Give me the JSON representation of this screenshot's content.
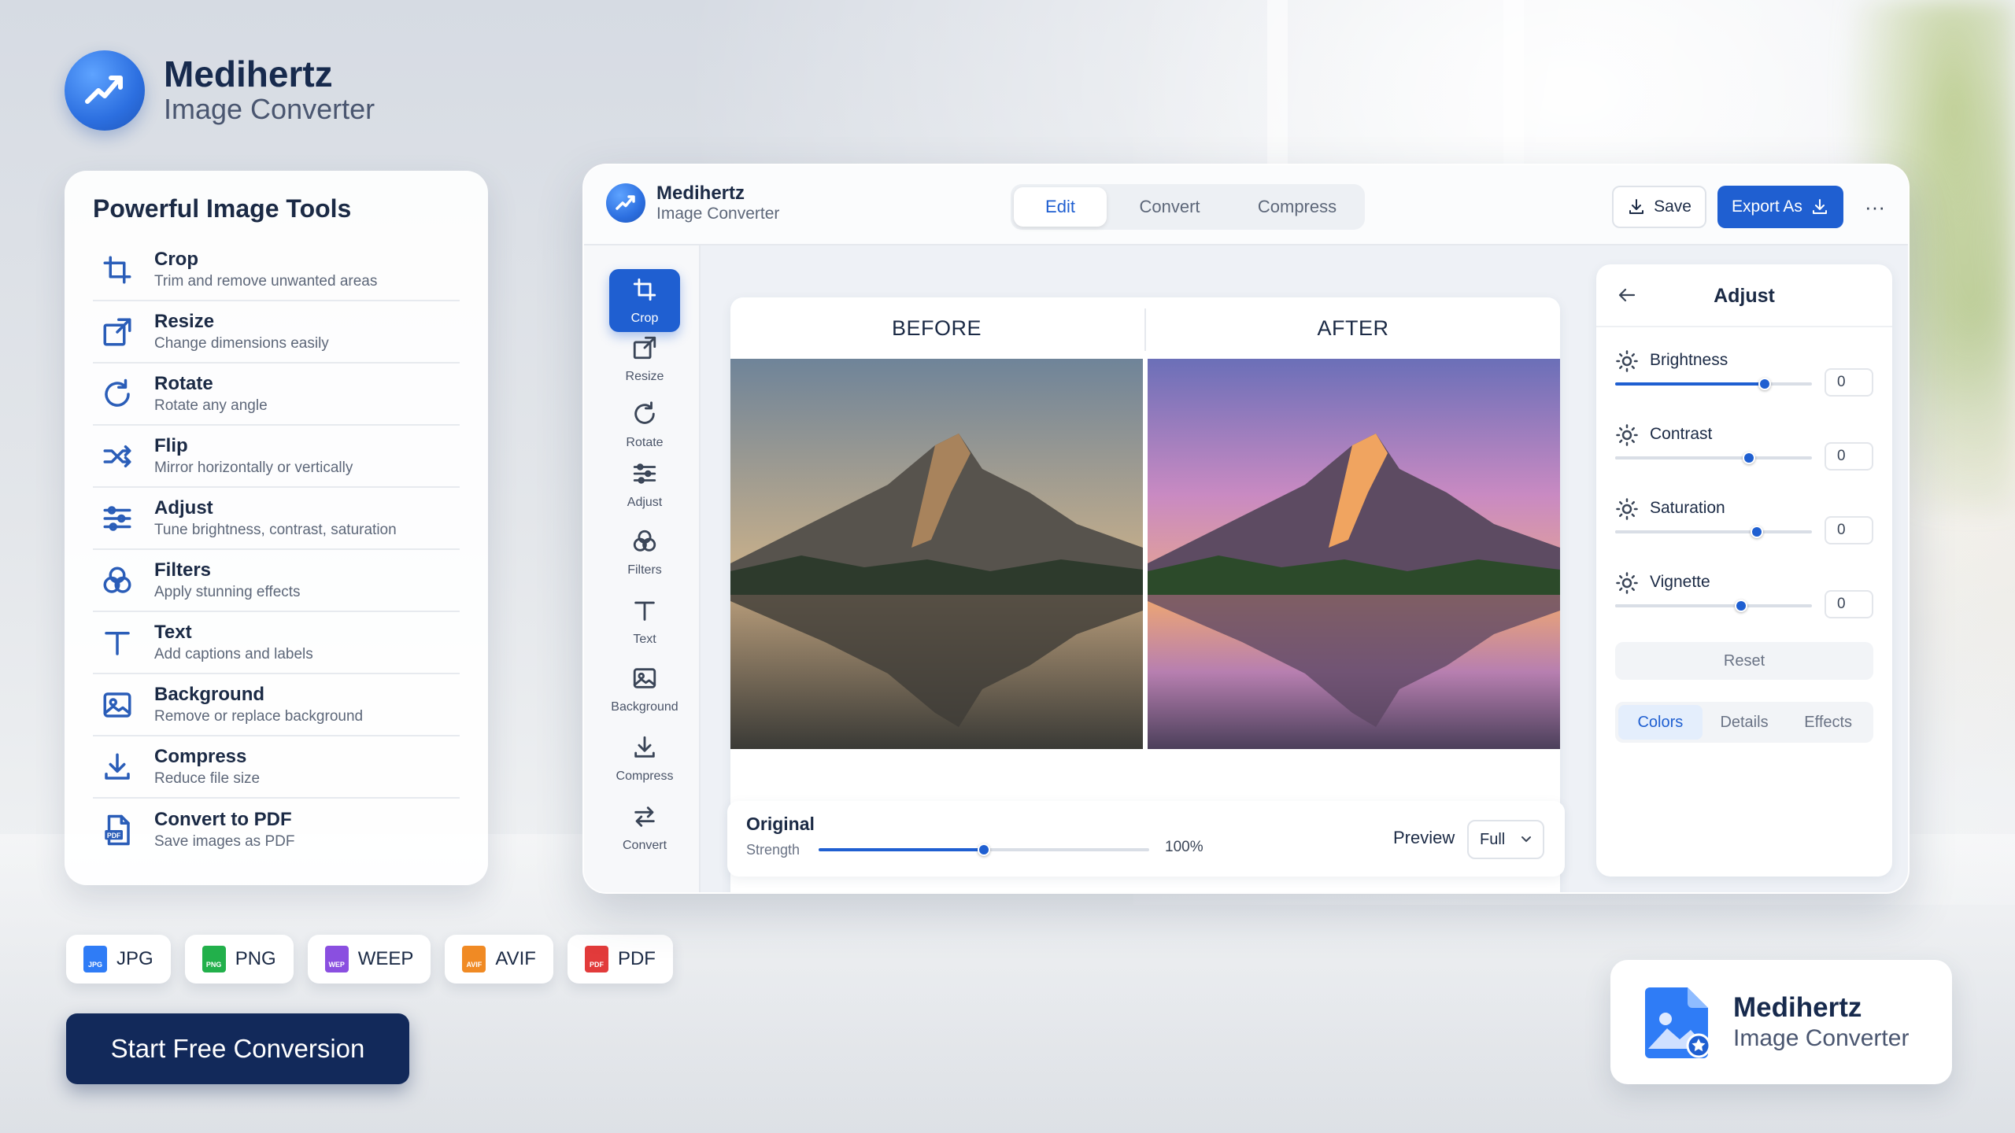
{
  "brand": {
    "name": "Medihertz",
    "subtitle": "Image Converter"
  },
  "tools_card": {
    "title": "Powerful Image Tools",
    "items": [
      {
        "name": "Crop",
        "desc": "Trim  and remove unwanted areas",
        "icon": "crop-icon"
      },
      {
        "name": "Resize",
        "desc": "Change dimensions easily",
        "icon": "resize-icon"
      },
      {
        "name": "Rotate",
        "desc": "Rotate any angle",
        "icon": "rotate-icon"
      },
      {
        "name": "Flip",
        "desc": "Mirror horizontally or vertically",
        "icon": "flip-icon"
      },
      {
        "name": "Adjust",
        "desc": "Tune brightness, contrast, saturation",
        "icon": "sliders-icon"
      },
      {
        "name": "Filters",
        "desc": "Apply stunning effects",
        "icon": "filters-icon"
      },
      {
        "name": "Text",
        "desc": "Add captions and labels",
        "icon": "text-icon"
      },
      {
        "name": "Background",
        "desc": "Remove or replace background",
        "icon": "image-icon"
      },
      {
        "name": "Compress",
        "desc": "Reduce file size",
        "icon": "download-icon"
      },
      {
        "name": "Convert to PDF",
        "desc": "Save images as PDF",
        "icon": "pdf-file-icon"
      }
    ]
  },
  "formats": [
    {
      "label": "JPG",
      "badge": "JPG",
      "color": "#2f7cf6"
    },
    {
      "label": "PNG",
      "badge": "PNG",
      "color": "#22b04b"
    },
    {
      "label": "WEEP",
      "badge": "WEP",
      "color": "#8a4fe0"
    },
    {
      "label": "AVIF",
      "badge": "AVIF",
      "color": "#f08a24"
    },
    {
      "label": "PDF",
      "badge": "PDF",
      "color": "#e23b3b"
    }
  ],
  "cta": {
    "label": "Start Free Conversion"
  },
  "editor": {
    "brand_name": "Medihertz",
    "brand_sub": "Image Converter",
    "tabs": [
      {
        "label": "Edit",
        "active": true
      },
      {
        "label": "Convert",
        "active": false
      },
      {
        "label": "Compress",
        "active": false
      }
    ],
    "save_label": "Save",
    "export_label": "Export As",
    "more_label": "···",
    "rail": [
      {
        "label": "Crop",
        "active": true
      },
      {
        "label": "Resize"
      },
      {
        "label": "Rotate"
      },
      {
        "label": "Adjust"
      },
      {
        "label": "Filters"
      },
      {
        "label": "Text"
      },
      {
        "label": "Background"
      },
      {
        "label": "Compress"
      },
      {
        "label": "Convert"
      }
    ],
    "before_label": "BEFORE",
    "after_label": "AFTER",
    "strength": {
      "title": "Original",
      "label": "Strength",
      "value": 0.5,
      "value_text": "100%"
    },
    "preview": {
      "label": "Preview",
      "selected": "Full"
    },
    "adjust": {
      "title": "Adjust",
      "sliders": [
        {
          "label": "Brightness",
          "value": "0",
          "level": 0.76
        },
        {
          "label": "Contrast",
          "value": "0",
          "level": 0.68
        },
        {
          "label": "Saturation",
          "value": "0",
          "level": 0.72
        },
        {
          "label": "Vignette",
          "value": "0",
          "level": 0.64
        }
      ],
      "reset_label": "Reset",
      "tabs": [
        {
          "label": "Colors",
          "active": true
        },
        {
          "label": "Details",
          "active": false
        },
        {
          "label": "Effects",
          "active": false
        }
      ]
    }
  },
  "badge_card": {
    "name": "Medihertz",
    "subtitle": "Image Converter"
  },
  "colors": {
    "accent": "#1f5fd1",
    "navy": "#12295a"
  }
}
